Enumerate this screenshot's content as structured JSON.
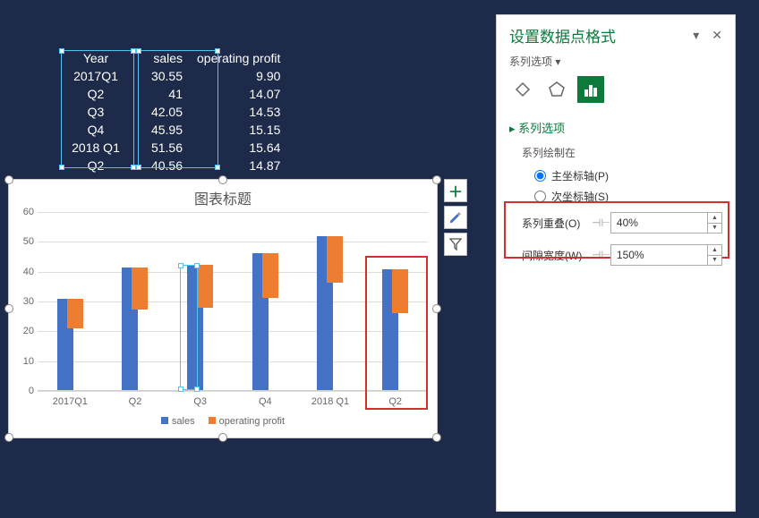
{
  "table": {
    "headers": [
      "Year",
      "sales",
      "operating profit"
    ],
    "rows": [
      [
        "2017Q1",
        "30.55",
        "9.90"
      ],
      [
        "Q2",
        "41",
        "14.07"
      ],
      [
        "Q3",
        "42.05",
        "14.53"
      ],
      [
        "Q4",
        "45.95",
        "15.15"
      ],
      [
        "2018 Q1",
        "51.56",
        "15.64"
      ],
      [
        "Q2",
        "40.56",
        "14.87"
      ]
    ]
  },
  "chart_data": {
    "type": "bar",
    "title": "图表标题",
    "categories": [
      "2017Q1",
      "Q2",
      "Q3",
      "Q4",
      "2018 Q1",
      "Q2"
    ],
    "series": [
      {
        "name": "sales",
        "values": [
          30.55,
          41,
          42.05,
          45.95,
          51.56,
          40.56
        ],
        "color": "#4472c4"
      },
      {
        "name": "operating profit",
        "values": [
          9.9,
          14.07,
          14.53,
          15.15,
          15.64,
          14.87
        ],
        "color": "#ed7d31"
      }
    ],
    "ylim": [
      0,
      60
    ],
    "ytick_interval": 10,
    "xlabel": "",
    "ylabel": ""
  },
  "side_buttons": {
    "add": "+",
    "brush": "brush",
    "filter": "filter"
  },
  "format_pane": {
    "title": "设置数据点格式",
    "dropdown_label": "系列选项 ▾",
    "section_header": "系列选项",
    "plot_on_label": "系列绘制在",
    "primary_axis": "主坐标轴(P)",
    "secondary_axis": "次坐标轴(S)",
    "overlap_label": "系列重叠(O)",
    "overlap_value": "40%",
    "gap_label": "间隙宽度(W)",
    "gap_value": "150%"
  }
}
